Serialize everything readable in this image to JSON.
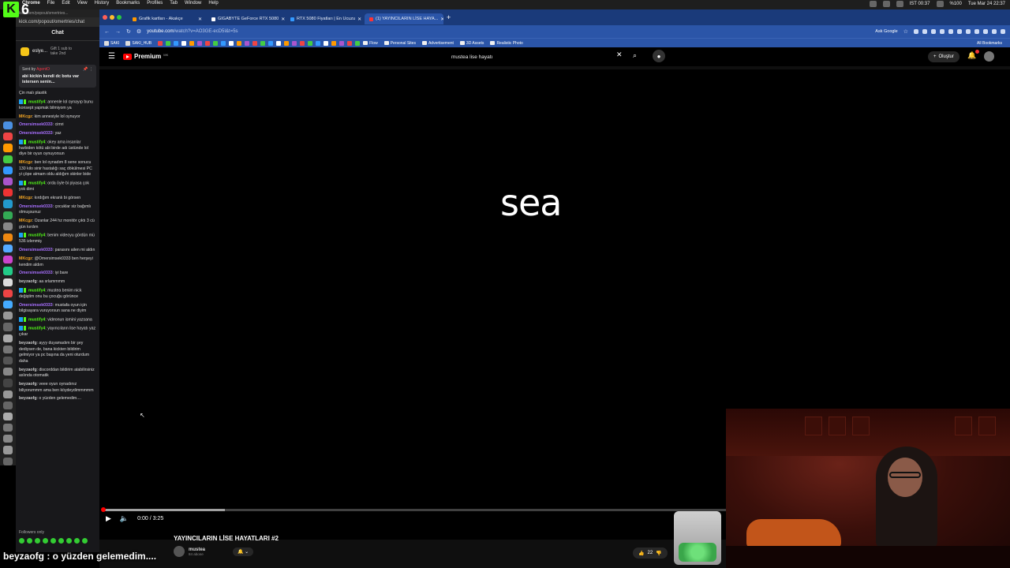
{
  "menubar": {
    "logo_letter": "K",
    "logo_number": "6",
    "menu": [
      "Chrome",
      "File",
      "Edit",
      "View",
      "History",
      "Bookmarks",
      "Profiles",
      "Tab",
      "Window",
      "Help"
    ],
    "clock": "IST 00:37",
    "battery": "%100",
    "datetime": "Tue Mar 24  22:37"
  },
  "chat": {
    "popout_url": "kick.com/popout/omertries/chat",
    "popout_url_short": "kick.com/popout/omertries...",
    "title": "Chat",
    "subscriber": {
      "name": "eslye...",
      "gift": "Gift 1 sub to take 2nd"
    },
    "pinned": {
      "sent_by_label": "Sent by",
      "sent_by_user": "AgentO",
      "text": "abi kickin kendi dc botu var istersen senin..."
    },
    "messages": [
      {
        "user": "",
        "text": "Çin malı plastik",
        "color": "b"
      },
      {
        "user": "mustify4",
        "text": "annenle lol oynayıp bunu konsept yapmak bilmiyom ya",
        "color": "m",
        "badges": true
      },
      {
        "user": "MKcgz",
        "text": "kim annesiyle lol oynuyor",
        "color": "k"
      },
      {
        "user": "Omersimsek0333",
        "text": "cimri",
        "color": "o"
      },
      {
        "user": "Omersimsek0333",
        "text": "yaz",
        "color": "o"
      },
      {
        "user": "mustify4",
        "text": "okey ama insanlar harbiden kötü abi birde adı üstünde lol diye bir oyun oynuyorsun",
        "color": "m",
        "badges": true
      },
      {
        "user": "MKcgz",
        "text": "ben lol oynadım 8 sene sonucu 130 kilo sinir hastalığı saç dökülmesi PC yi çöpe atmam oldu aldığım skinler bide",
        "color": "k"
      },
      {
        "user": "mustify4",
        "text": "orda öyle bi piyasa çok yok dimi",
        "color": "m",
        "badges": true
      },
      {
        "user": "MKcgz",
        "text": "kırdığım ekranlı bi görsen",
        "color": "k"
      },
      {
        "user": "Omersimsek0333",
        "text": "çocuklar siz bağımlı olmuşsunuz",
        "color": "o"
      },
      {
        "user": "MKcgz",
        "text": "Ozanlar 244 hz monitör çıktı 3 cü gün kırdım",
        "color": "k"
      },
      {
        "user": "mustify4",
        "text": "benim videoyu gördün mü 536 izlenmiş",
        "color": "m",
        "badges": true
      },
      {
        "user": "Omersimsek0333",
        "text": "parasını ailen mi aldın",
        "color": "o"
      },
      {
        "user": "MKcgz",
        "text": "@Omersimsek0333 ben herşeyi kendim aldım",
        "color": "k"
      },
      {
        "user": "Omersimsek0333",
        "text": "iyi bare",
        "color": "o"
      },
      {
        "user": "beyzaofg",
        "text": "aa srlammmm",
        "color": "b"
      },
      {
        "user": "mustify4",
        "text": "mustea benim nick değiştim onu bu çocuğu görünce",
        "color": "m",
        "badges": true
      },
      {
        "user": "Omersimsek0333",
        "text": "mustafa oyun için bilgisayara vuruyorsun sana ne diyim",
        "color": "o"
      },
      {
        "user": "mustify4",
        "text": "videonun ismini yazsana",
        "color": "m",
        "badges": true
      },
      {
        "user": "mustify4",
        "text": "yayıncıların lise hayatı yaz çıkar",
        "color": "m",
        "badges": true
      },
      {
        "user": "beyzaofg",
        "text": "ayyy duyamadım bir şey dediysen de, bana kickten bildirim gelmiyor ya pc başına da yeni oturdum daha",
        "color": "b"
      },
      {
        "user": "beyzaofg",
        "text": "discorddan bildirim atabilirsiniz aslında otomatik",
        "color": "b"
      },
      {
        "user": "beyzaofg",
        "text": "veee oyun oynadınız biliyorummm ama ben köydeydimmmmm",
        "color": "b"
      },
      {
        "user": "beyzaofg",
        "text": "o yüzden gelemedim....",
        "color": "b"
      }
    ],
    "followers_only": "Followers only",
    "caption": "beyzaofg : o yüzden gelemedim...."
  },
  "browser": {
    "tabs": [
      {
        "label": "Grafik kartları - Akakçe",
        "color": "#f90"
      },
      {
        "label": "GIGABYTE GeForce RTX 5080",
        "color": "#fff"
      },
      {
        "label": "RTX 5080 Fiyatları | En Ucuzu",
        "color": "#39f"
      },
      {
        "label": "(1) YAYINCILARIN LİSE HAYA...",
        "color": "#f33",
        "active": true
      }
    ],
    "url_main": "youtube.com",
    "url_rest": "/watch?v=AO3GE-ecD5I&t=5s",
    "ask_google": "Ask Google",
    "bookmarks": [
      {
        "label": "SAKI"
      },
      {
        "label": "SAKI_HUB"
      }
    ],
    "folders": [
      "Flow",
      "Personal Sites",
      "Advertisement",
      "3D Assets",
      "Realistic Photo"
    ],
    "all_bookmarks": "All Bookmarks"
  },
  "youtube": {
    "logo_word": "Premium",
    "logo_region": "MK",
    "search_value": "mustea lise hayatı",
    "create_label": "Oluştur",
    "video_text": "sea",
    "time": "0:00 / 3:25",
    "progress_fraction": 0.0,
    "buffered_fraction": 0.135,
    "title": "YAYINCILARIN LİSE HAYATLARI #2",
    "channel_name": "mustea",
    "channel_subs": "84 abone",
    "likes": "22"
  }
}
